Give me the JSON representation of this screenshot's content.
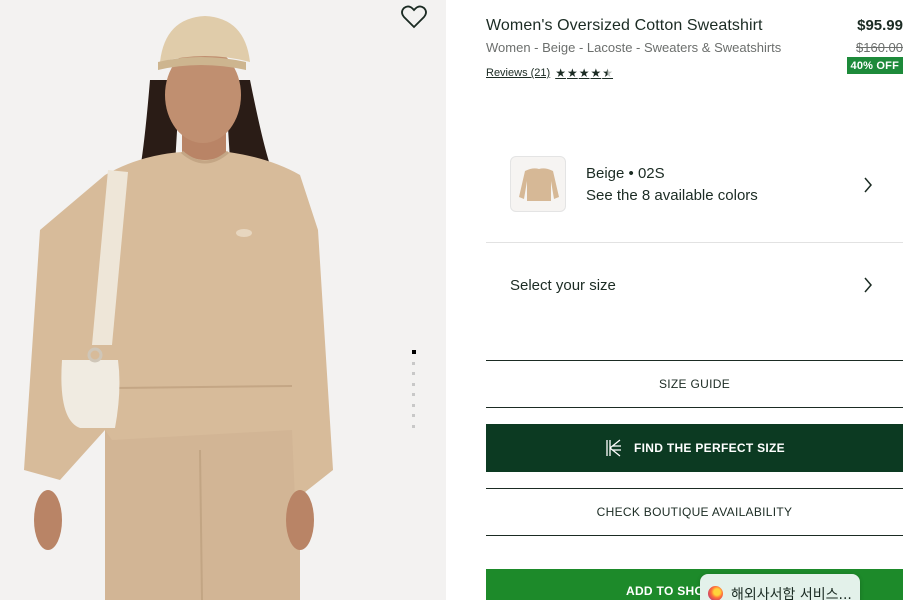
{
  "product": {
    "title": "Women's Oversized Cotton Sweatshirt",
    "breadcrumb": "Women - Beige - Lacoste - Sweaters & Sweatshirts",
    "reviews_label": "Reviews (21)",
    "rating": 4.5,
    "price": "$95.99",
    "old_price": "$160.00",
    "discount_badge": "40% OFF"
  },
  "color": {
    "name": "Beige • 02S",
    "subtitle": "See the 8 available colors"
  },
  "size": {
    "label": "Select your size"
  },
  "buttons": {
    "size_guide": "SIZE GUIDE",
    "perfect_size": "FIND THE PERFECT SIZE",
    "boutique": "CHECK BOUTIQUE AVAILABILITY",
    "add_to_cart": "ADD TO SHO"
  },
  "gallery": {
    "image_count": 8,
    "active_index": 0
  },
  "popup": {
    "text": "해외사서함 서비스..."
  },
  "colors": {
    "dark_green": "#0c3a22",
    "green": "#1d8a2a",
    "badge": "#1d8a3a",
    "beige": "#d2b595"
  }
}
